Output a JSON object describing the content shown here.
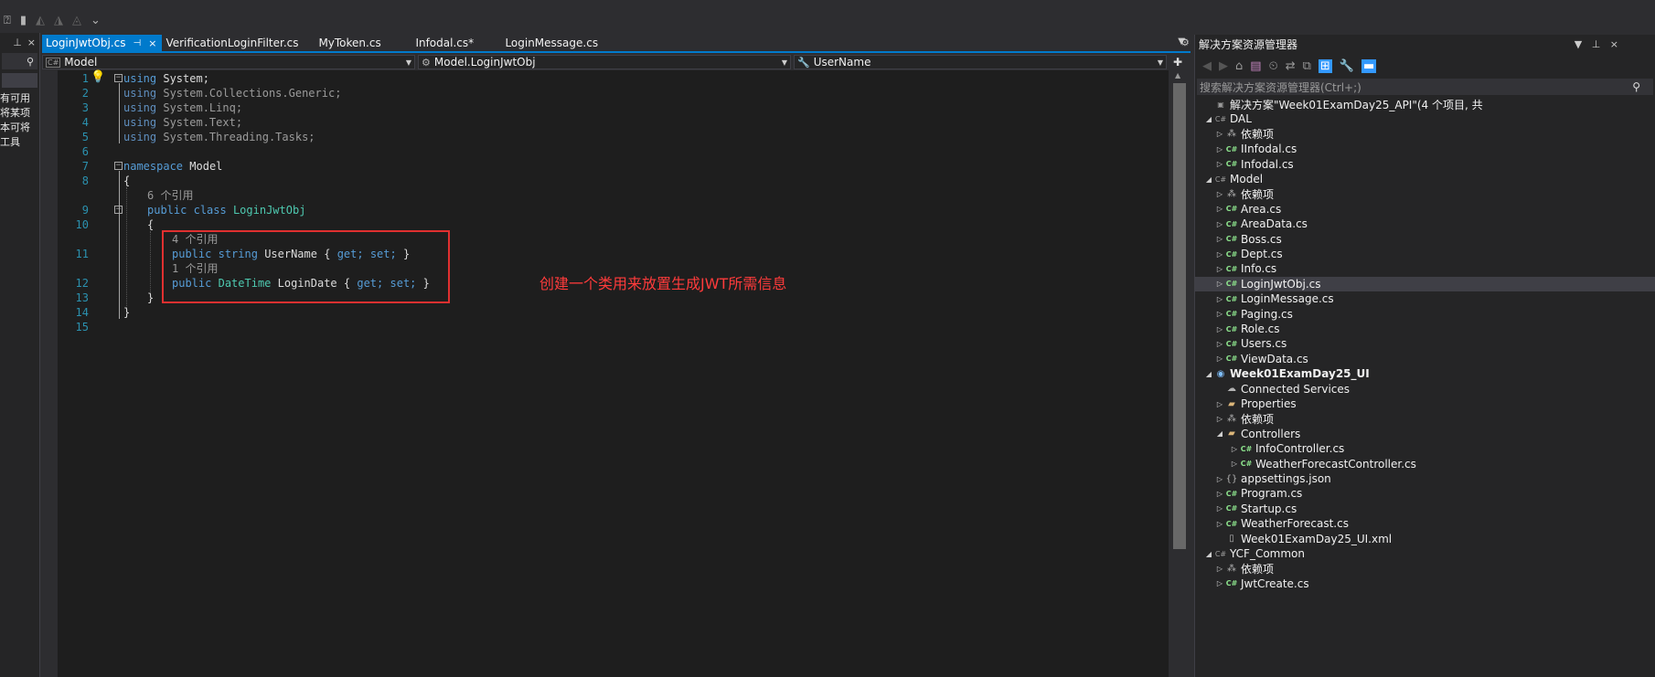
{
  "tabs": [
    {
      "label": "LoginJwtObj.cs",
      "active": true
    },
    {
      "label": "VerificationLoginFilter.cs",
      "active": false
    },
    {
      "label": "MyToken.cs",
      "active": false
    },
    {
      "label": "Infodal.cs*",
      "active": false
    },
    {
      "label": "LoginMessage.cs",
      "active": false
    }
  ],
  "navbar": {
    "project": "Model",
    "type": "Model.LoginJwtObj",
    "member": "UserName"
  },
  "left_strip": {
    "lines": [
      "有可用",
      "将某项",
      "本可将",
      "工具"
    ]
  },
  "code": {
    "line_numbers": [
      "1",
      "2",
      "3",
      "4",
      "5",
      "6",
      "7",
      "8",
      "9",
      "10",
      "11",
      "12",
      "13",
      "14",
      "15"
    ],
    "using_kw": "using",
    "using1": "System;",
    "using2": "System.Collections.Generic;",
    "using3": "System.Linq;",
    "using4": "System.Text;",
    "using5": "System.Threading.Tasks;",
    "namespace_kw": "namespace",
    "namespace_name": "Model",
    "open_brace": "{",
    "close_brace": "}",
    "lens_class": "6 个引用",
    "public_kw": "public",
    "class_kw": "class",
    "class_name": "LoginJwtObj",
    "lens_username": "4 个引用",
    "string_kw": "string",
    "username_prop": "UserName",
    "get_kw": "get;",
    "set_kw": "set;",
    "lens_logindate": "1 个引用",
    "datetime_type": "DateTime",
    "logindate_prop": "LoginDate",
    "brace_open_inline": "{",
    "brace_close_inline": "}"
  },
  "annotation": "创建一个类用来放置生成JWT所需信息",
  "solution_explorer": {
    "title": "解决方案资源管理器",
    "search_placeholder": "搜索解决方案资源管理器(Ctrl+;)",
    "items": [
      {
        "label": "解决方案\"Week01ExamDay25_API\"(4 个项目, 共",
        "level": 0,
        "icon": "sln",
        "twisty": ""
      },
      {
        "label": "DAL",
        "level": 0,
        "icon": "proj",
        "twisty": "open"
      },
      {
        "label": "依赖项",
        "level": 1,
        "icon": "deps",
        "twisty": "closed"
      },
      {
        "label": "IInfodal.cs",
        "level": 1,
        "icon": "cs",
        "twisty": "closed"
      },
      {
        "label": "Infodal.cs",
        "level": 1,
        "icon": "cs",
        "twisty": "closed"
      },
      {
        "label": "Model",
        "level": 0,
        "icon": "proj",
        "twisty": "open"
      },
      {
        "label": "依赖项",
        "level": 1,
        "icon": "deps",
        "twisty": "closed"
      },
      {
        "label": "Area.cs",
        "level": 1,
        "icon": "cs",
        "twisty": "closed"
      },
      {
        "label": "AreaData.cs",
        "level": 1,
        "icon": "cs",
        "twisty": "closed"
      },
      {
        "label": "Boss.cs",
        "level": 1,
        "icon": "cs",
        "twisty": "closed"
      },
      {
        "label": "Dept.cs",
        "level": 1,
        "icon": "cs",
        "twisty": "closed"
      },
      {
        "label": "Info.cs",
        "level": 1,
        "icon": "cs",
        "twisty": "closed"
      },
      {
        "label": "LoginJwtObj.cs",
        "level": 1,
        "icon": "cs",
        "twisty": "closed",
        "selected": true
      },
      {
        "label": "LoginMessage.cs",
        "level": 1,
        "icon": "cs",
        "twisty": "closed"
      },
      {
        "label": "Paging.cs",
        "level": 1,
        "icon": "cs",
        "twisty": "closed"
      },
      {
        "label": "Role.cs",
        "level": 1,
        "icon": "cs",
        "twisty": "closed"
      },
      {
        "label": "Users.cs",
        "level": 1,
        "icon": "cs",
        "twisty": "closed"
      },
      {
        "label": "ViewData.cs",
        "level": 1,
        "icon": "cs",
        "twisty": "closed"
      },
      {
        "label": "Week01ExamDay25_UI",
        "level": 0,
        "icon": "web",
        "twisty": "open",
        "bold": true
      },
      {
        "label": "Connected Services",
        "level": 1,
        "icon": "service",
        "twisty": ""
      },
      {
        "label": "Properties",
        "level": 1,
        "icon": "folder",
        "twisty": "closed"
      },
      {
        "label": "依赖项",
        "level": 1,
        "icon": "deps",
        "twisty": "closed"
      },
      {
        "label": "Controllers",
        "level": 1,
        "icon": "folder",
        "twisty": "open"
      },
      {
        "label": "InfoController.cs",
        "level": 2,
        "icon": "cs",
        "twisty": "closed"
      },
      {
        "label": "WeatherForecastController.cs",
        "level": 2,
        "icon": "cs",
        "twisty": "closed"
      },
      {
        "label": "appsettings.json",
        "level": 1,
        "icon": "json",
        "twisty": "closed"
      },
      {
        "label": "Program.cs",
        "level": 1,
        "icon": "cs",
        "twisty": "closed"
      },
      {
        "label": "Startup.cs",
        "level": 1,
        "icon": "cs",
        "twisty": "closed"
      },
      {
        "label": "WeatherForecast.cs",
        "level": 1,
        "icon": "cs",
        "twisty": "closed"
      },
      {
        "label": "Week01ExamDay25_UI.xml",
        "level": 1,
        "icon": "file",
        "twisty": ""
      },
      {
        "label": "YCF_Common",
        "level": 0,
        "icon": "proj",
        "twisty": "open"
      },
      {
        "label": "依赖项",
        "level": 1,
        "icon": "deps",
        "twisty": "closed"
      },
      {
        "label": "JwtCreate.cs",
        "level": 1,
        "icon": "cs",
        "twisty": "closed"
      }
    ]
  }
}
